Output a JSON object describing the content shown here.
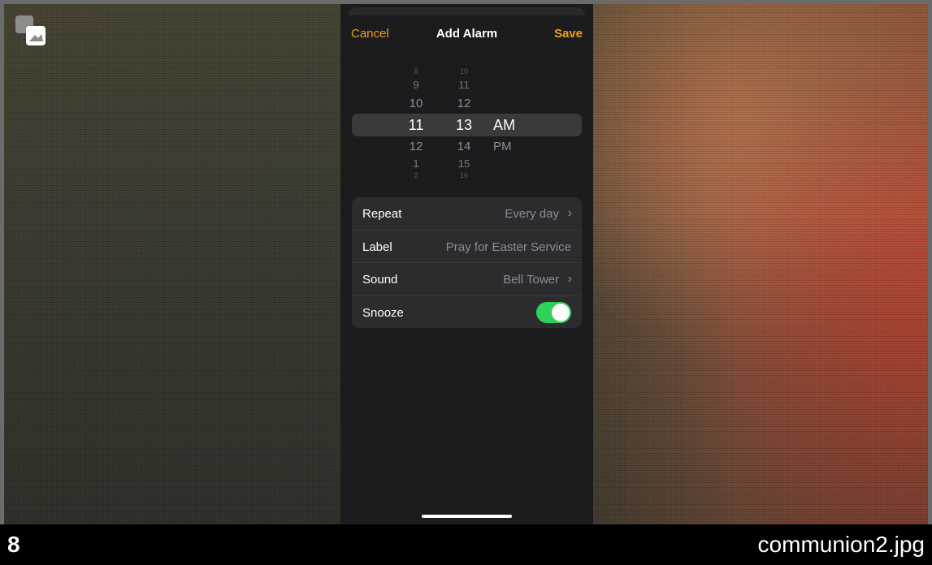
{
  "nav": {
    "cancel": "Cancel",
    "title": "Add Alarm",
    "save": "Save"
  },
  "picker": {
    "hours": [
      "8",
      "9",
      "10",
      "11",
      "12",
      "1",
      "2"
    ],
    "minutes": [
      "10",
      "11",
      "12",
      "13",
      "14",
      "15",
      "16"
    ],
    "periods": [
      "AM",
      "PM"
    ],
    "selected": {
      "hour": "11",
      "minute": "13",
      "period": "AM"
    }
  },
  "settings": {
    "repeat": {
      "label": "Repeat",
      "value": "Every day"
    },
    "label": {
      "label": "Label",
      "value": "Pray for Easter Service"
    },
    "sound": {
      "label": "Sound",
      "value": "Bell Tower"
    },
    "snooze": {
      "label": "Snooze",
      "on": true
    }
  },
  "caption": {
    "index": "8",
    "filename": "communion2.jpg"
  },
  "colors": {
    "accent": "#f0a30a",
    "toggle_on": "#30d158",
    "panel_bg": "#1c1c1e"
  },
  "icons": {
    "pip": "picture-in-picture-icon",
    "chevron": "chevron-right-icon"
  }
}
